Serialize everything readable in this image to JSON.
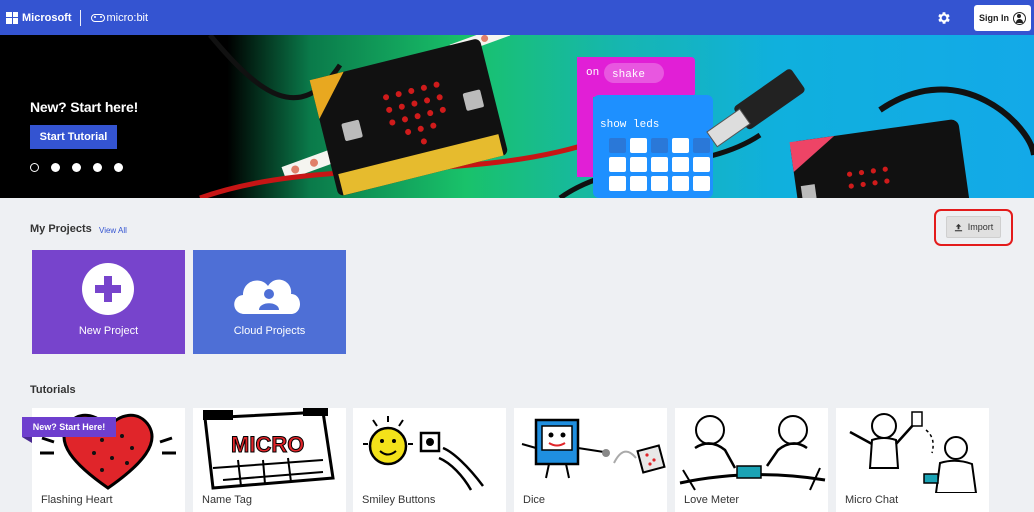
{
  "header": {
    "brand": "Microsoft",
    "product": "micro:bit",
    "sign_in": "Sign In",
    "bg_color": "#3454d1"
  },
  "hero": {
    "title": "New? Start here!",
    "button": "Start Tutorial",
    "slides": 5,
    "active_slide": 1,
    "code_block_event": "on",
    "code_block_event_value": "shake",
    "code_block_action": "show leds"
  },
  "projects": {
    "title": "My Projects",
    "view_all": "View All",
    "import": "Import",
    "cards": [
      {
        "label": "New Project",
        "icon": "plus-icon",
        "color": "#7744cc"
      },
      {
        "label": "Cloud Projects",
        "icon": "cloud-user-icon",
        "color": "#4e6fd6"
      }
    ]
  },
  "tutorials": {
    "title": "Tutorials",
    "badge": "New? Start Here!",
    "items": [
      {
        "label": "Flashing Heart",
        "icon": "heart-icon"
      },
      {
        "label": "Name Tag",
        "icon": "name-tag-icon",
        "art_text": "MICRO"
      },
      {
        "label": "Smiley Buttons",
        "icon": "smiley-icon"
      },
      {
        "label": "Dice",
        "icon": "dice-icon"
      },
      {
        "label": "Love Meter",
        "icon": "love-meter-icon"
      },
      {
        "label": "Micro Chat",
        "icon": "chat-icon"
      }
    ]
  }
}
